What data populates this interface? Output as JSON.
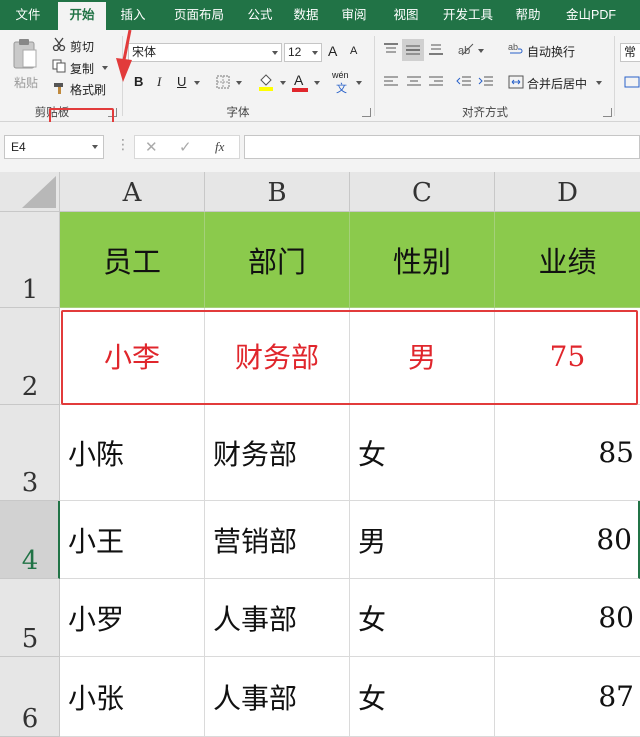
{
  "menu": {
    "tabs": [
      "文件",
      "开始",
      "插入",
      "页面布局",
      "公式",
      "数据",
      "审阅",
      "视图",
      "开发工具",
      "帮助",
      "金山PDF"
    ],
    "active": "开始"
  },
  "ribbon": {
    "clipboard": {
      "paste": "粘贴",
      "cut": "剪切",
      "copy": "复制",
      "format_painter": "格式刷",
      "label": "剪贴板"
    },
    "font": {
      "font_name": "宋体",
      "font_size": "12",
      "grow": "A",
      "shrink": "A",
      "bold": "B",
      "italic": "I",
      "underline": "U",
      "font_color_glyph": "A",
      "phonetic": "wén",
      "phonetic_sub": "文",
      "label": "字体"
    },
    "alignment": {
      "wrap_text": "自动换行",
      "merge_center": "合并后居中",
      "label": "对齐方式"
    },
    "number": {
      "format": "常规"
    }
  },
  "formula_bar": {
    "name_box": "E4",
    "cancel": "✕",
    "confirm": "✓",
    "fx": "fx",
    "value": ""
  },
  "grid": {
    "columns": [
      "A",
      "B",
      "C",
      "D"
    ],
    "rows": [
      {
        "num": "1",
        "cells": [
          "员工",
          "部门",
          "性别",
          "业绩"
        ]
      },
      {
        "num": "2",
        "cells": [
          "小李",
          "财务部",
          "男",
          "75"
        ]
      },
      {
        "num": "3",
        "cells": [
          "小陈",
          "财务部",
          "女",
          "85"
        ]
      },
      {
        "num": "4",
        "cells": [
          "小王",
          "营销部",
          "男",
          "80"
        ]
      },
      {
        "num": "5",
        "cells": [
          "小罗",
          "人事部",
          "女",
          "80"
        ]
      },
      {
        "num": "6",
        "cells": [
          "小张",
          "人事部",
          "女",
          "87"
        ]
      }
    ],
    "selected_row": "4"
  },
  "colors": {
    "header_fill": "#8bca4c",
    "accent": "#217346",
    "highlight_red": "#e23b3b",
    "text_red": "#e0262c"
  }
}
